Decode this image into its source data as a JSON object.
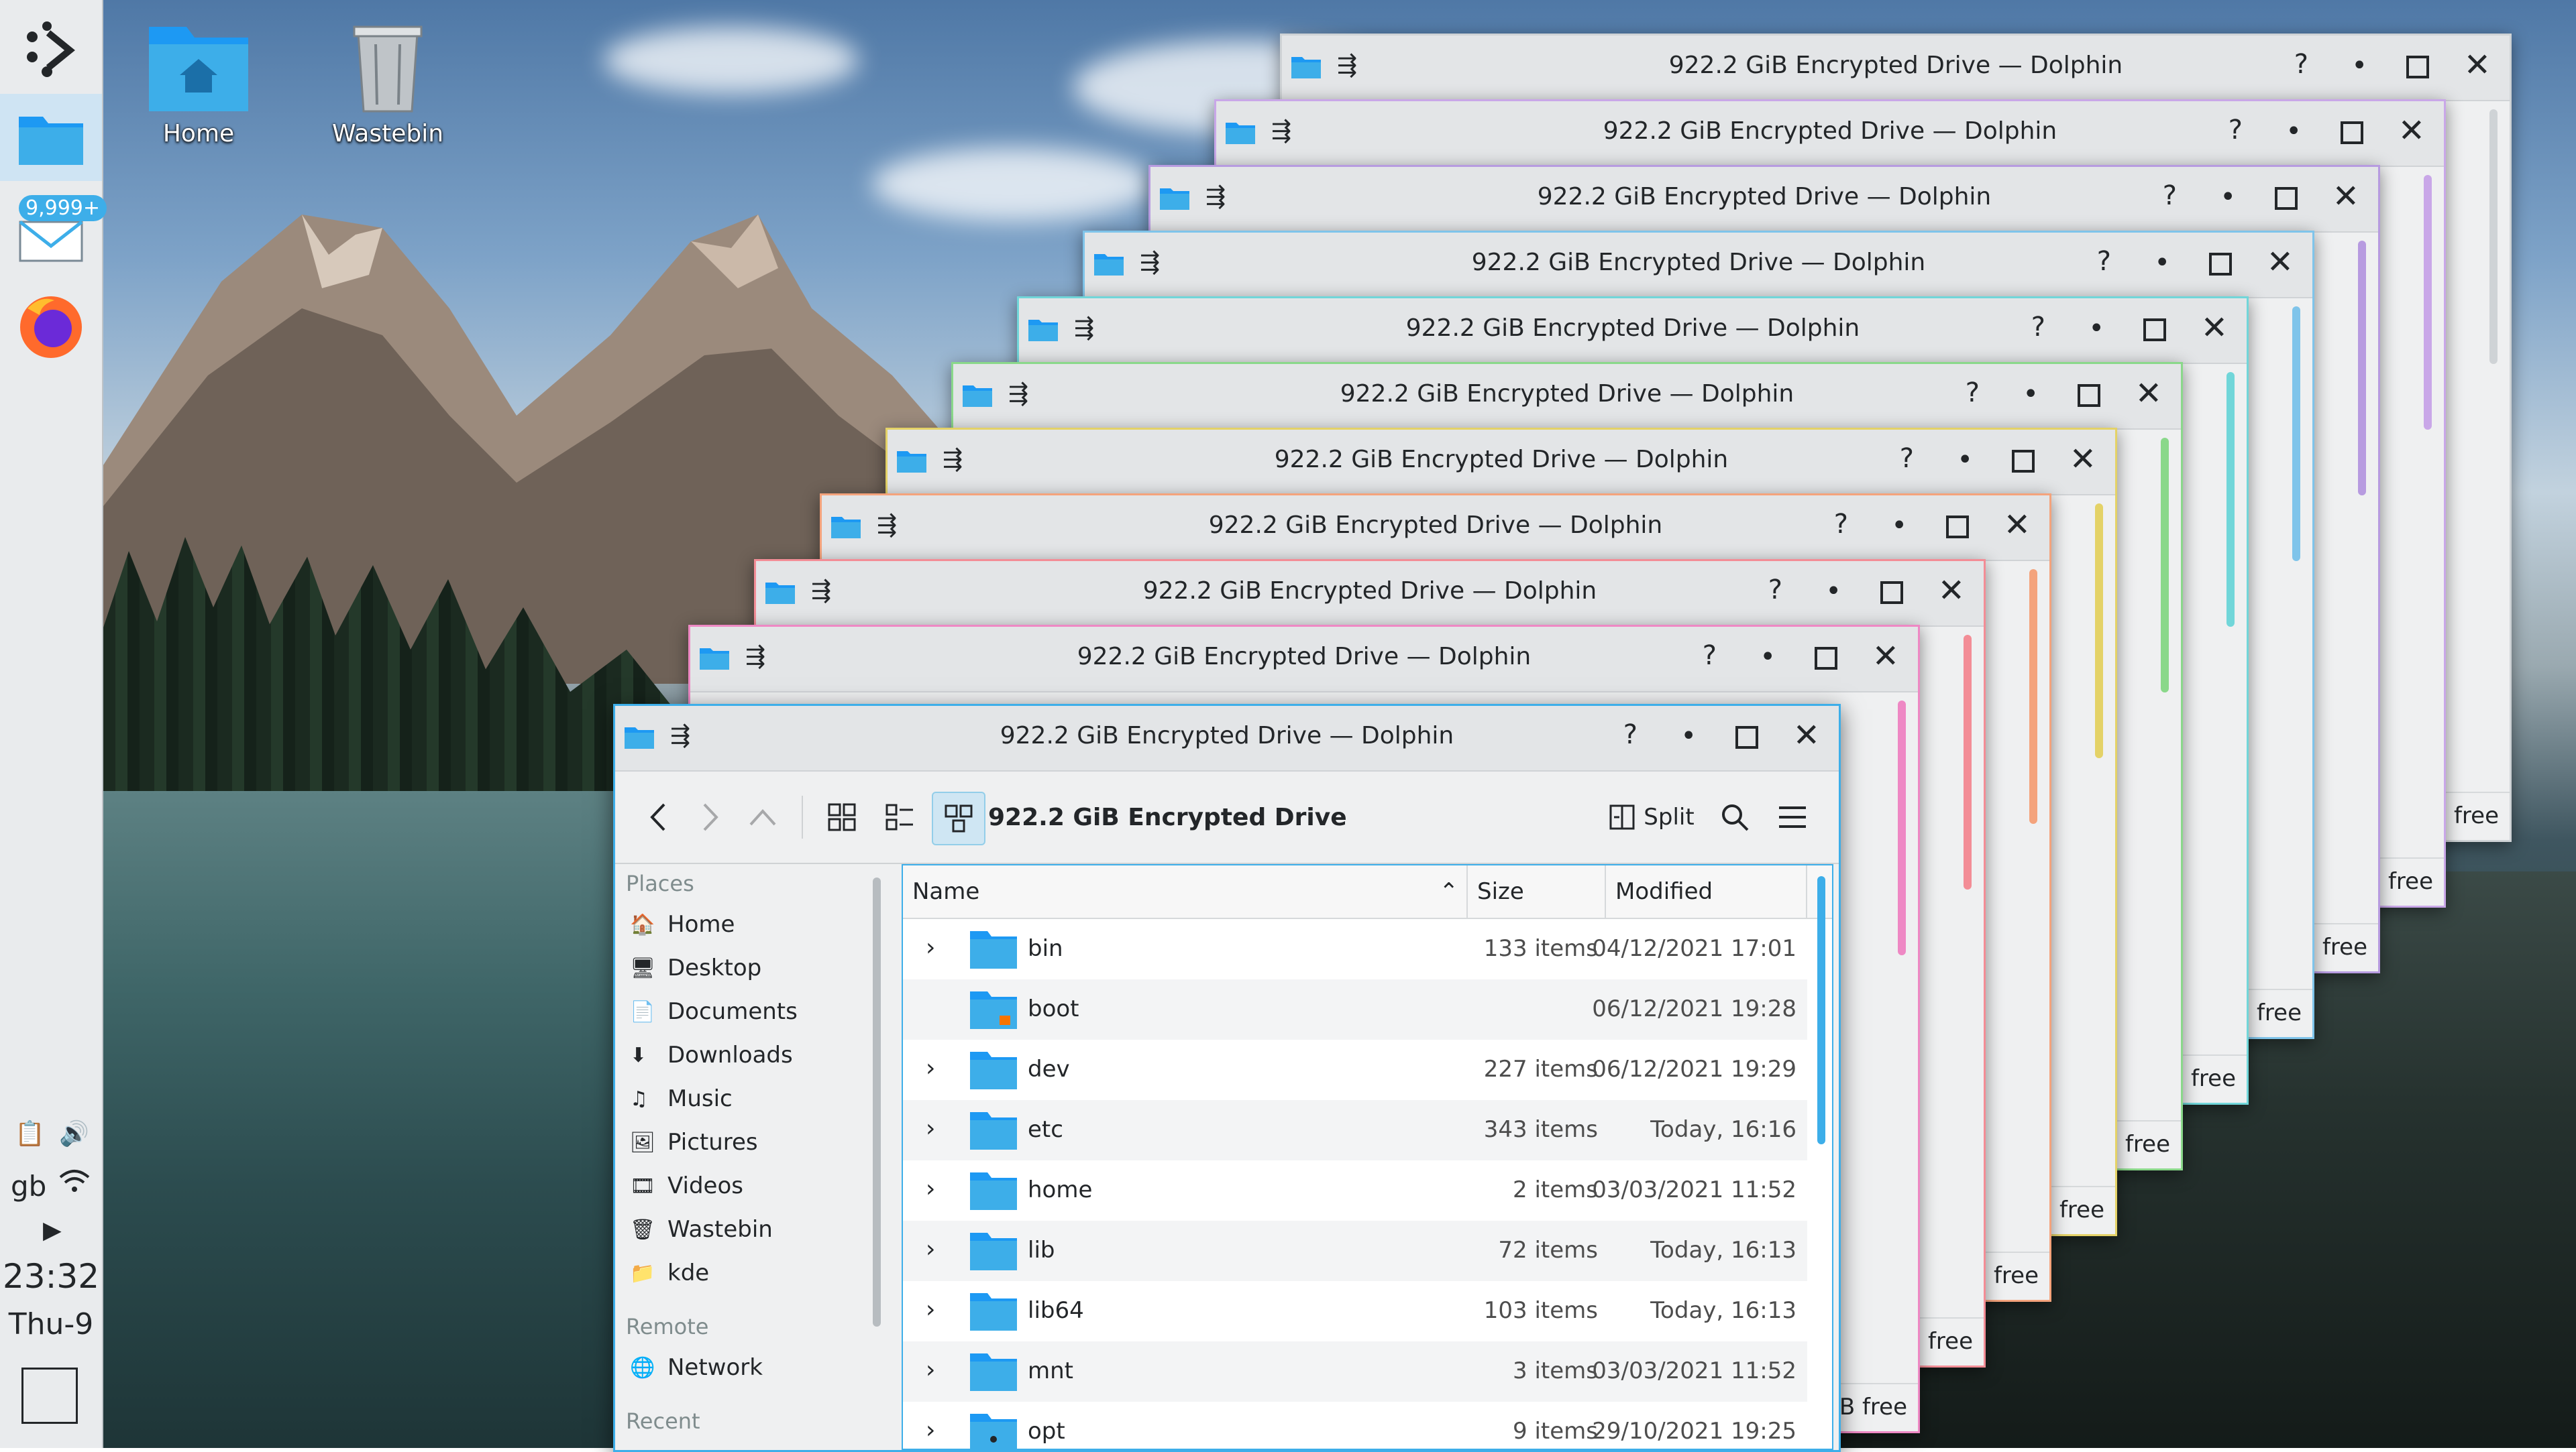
{
  "desktop": {
    "icons": [
      {
        "label": "Home"
      },
      {
        "label": "Wastebin"
      }
    ]
  },
  "panel": {
    "mail_badge": "9,999+",
    "keyboard_layout": "gb",
    "clock_time": "23:32",
    "clock_date": "Thu-9"
  },
  "window_title": "922.2 GiB Encrypted Drive — Dolphin",
  "background_windows": {
    "free_label": "B free",
    "border_colors": [
      "#cfd3d6",
      "#c9a7e8",
      "#b79be0",
      "#7fc4ea",
      "#71d6d9",
      "#8ad88a",
      "#e4d267",
      "#f4a37c",
      "#f38d96",
      "#ee88c4"
    ]
  },
  "main": {
    "titlebar": {
      "help": "?",
      "minimize": "•",
      "close": "✕"
    },
    "toolbar": {
      "location": "922.2 GiB Encrypted Drive",
      "split_label": "Split"
    },
    "places": {
      "sections": [
        {
          "title": "Places",
          "items": [
            "Home",
            "Desktop",
            "Documents",
            "Downloads",
            "Music",
            "Pictures",
            "Videos",
            "Wastebin",
            "kde"
          ]
        },
        {
          "title": "Remote",
          "items": [
            "Network"
          ]
        },
        {
          "title": "Recent",
          "items": []
        }
      ]
    },
    "columns": {
      "name": "Name",
      "size": "Size",
      "modified": "Modified"
    },
    "files": [
      {
        "name": "bin",
        "size": "133 items",
        "modified": "04/12/2021 17:01",
        "expandable": true
      },
      {
        "name": "boot",
        "size": "",
        "modified": "06/12/2021 19:28",
        "expandable": false
      },
      {
        "name": "dev",
        "size": "227 items",
        "modified": "06/12/2021 19:29",
        "expandable": true
      },
      {
        "name": "etc",
        "size": "343 items",
        "modified": "Today, 16:16",
        "expandable": true
      },
      {
        "name": "home",
        "size": "2 items",
        "modified": "03/03/2021 11:52",
        "expandable": true
      },
      {
        "name": "lib",
        "size": "72 items",
        "modified": "Today, 16:13",
        "expandable": true
      },
      {
        "name": "lib64",
        "size": "103 items",
        "modified": "Today, 16:13",
        "expandable": true
      },
      {
        "name": "mnt",
        "size": "3 items",
        "modified": "03/03/2021 11:52",
        "expandable": true
      },
      {
        "name": "opt",
        "size": "9 items",
        "modified": "29/10/2021 19:25",
        "expandable": true
      }
    ]
  }
}
